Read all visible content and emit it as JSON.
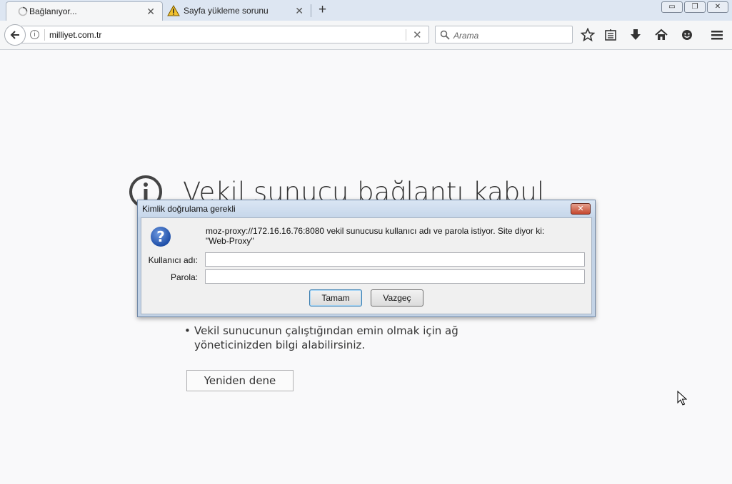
{
  "tabs": [
    {
      "label": "Bağlanıyor...",
      "state": "loading"
    },
    {
      "label": "Sayfa yükleme sorunu",
      "state": "warning"
    }
  ],
  "url": "milliyet.com.tr",
  "search": {
    "placeholder": "Arama"
  },
  "error_page": {
    "title": "Vekil sunucu bağlantı kabul",
    "bullet": "Vekil sunucunun çalıştığından emin olmak için ağ yöneticinizden bilgi alabilirsiniz.",
    "retry_label": "Yeniden dene"
  },
  "dialog": {
    "title": "Kimlik doğrulama gerekli",
    "message_line1": "moz-proxy://172.16.16.76:8080 vekil sunucusu kullanıcı adı ve parola istiyor. Site diyor ki:",
    "message_line2": "\"Web-Proxy\"",
    "username_label": "Kullanıcı adı:",
    "password_label": "Parola:",
    "ok_label": "Tamam",
    "cancel_label": "Vazgeç"
  },
  "colors": {
    "dialog_frame": "#c3d3e6",
    "page_bg": "#f9f9fa",
    "close_red": "#c4472e"
  }
}
